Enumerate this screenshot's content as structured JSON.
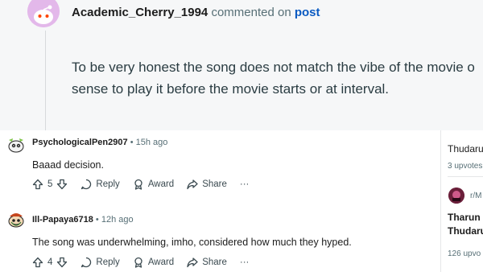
{
  "crosspost": {
    "author": "Academic_Cherry_1994",
    "action": "commented on",
    "target": "post",
    "body_line1": "To be very honest the song does not match the vibe of the movie o",
    "body_line2": "sense to play it before the movie starts or at interval."
  },
  "comments": [
    {
      "username": "PsychologicalPen2907",
      "separator": "•",
      "time": "15h ago",
      "text": "Baaad decision.",
      "votes": "5",
      "reply_label": "Reply",
      "award_label": "Award",
      "share_label": "Share",
      "more_label": "···"
    },
    {
      "username": "Ill-Papaya6718",
      "separator": "•",
      "time": "12h ago",
      "text": "The song was underwhelming, imho, considered how much they hyped.",
      "votes": "4",
      "reply_label": "Reply",
      "award_label": "Award",
      "share_label": "Share",
      "more_label": "···"
    }
  ],
  "sidebar": {
    "item1_title": "Thudaru",
    "item1_meta": "3 upvotes",
    "item2_community": "r/M",
    "item2_title_line1": "Tharun",
    "item2_title_line2": "Thudaru",
    "item2_meta": "126 upvo"
  },
  "colors": {
    "link": "#0a5ac2",
    "card_bg": "#f6f7f8",
    "muted": "#576f76"
  }
}
